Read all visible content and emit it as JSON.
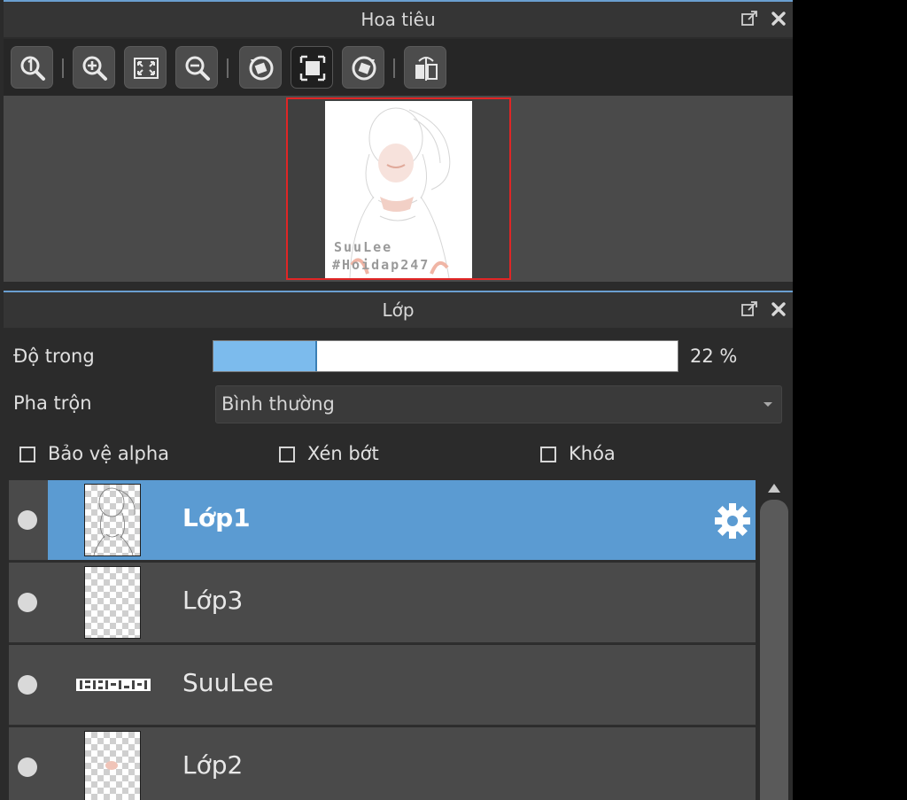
{
  "navigator": {
    "title": "Hoa tiêu",
    "toolbar": [
      "actual-size",
      "zoom-in",
      "fit-window",
      "zoom-out",
      "rotate-left",
      "fit-canvas",
      "rotate-right",
      "flip-horizontal"
    ],
    "watermark_line1": "SuuLee",
    "watermark_line2": "#Hoidap247"
  },
  "layers": {
    "title": "Lớp",
    "opacity_label": "Độ trong",
    "opacity_value": 22,
    "opacity_text": "22 %",
    "blend_label": "Pha trộn",
    "blend_value": "Bình thường",
    "checkboxes": [
      {
        "label": "Bảo vệ alpha",
        "checked": false
      },
      {
        "label": "Xén bớt",
        "checked": false
      },
      {
        "label": "Khóa",
        "checked": false
      }
    ],
    "items": [
      {
        "name": "Lớp1",
        "selected": true
      },
      {
        "name": "Lớp3",
        "selected": false
      },
      {
        "name": "SuuLee",
        "selected": false
      },
      {
        "name": "Lớp2",
        "selected": false
      }
    ]
  },
  "colors": {
    "accent": "#5b9bd2",
    "slider_fill": "#7cbbed",
    "frame_red": "#e02525"
  }
}
